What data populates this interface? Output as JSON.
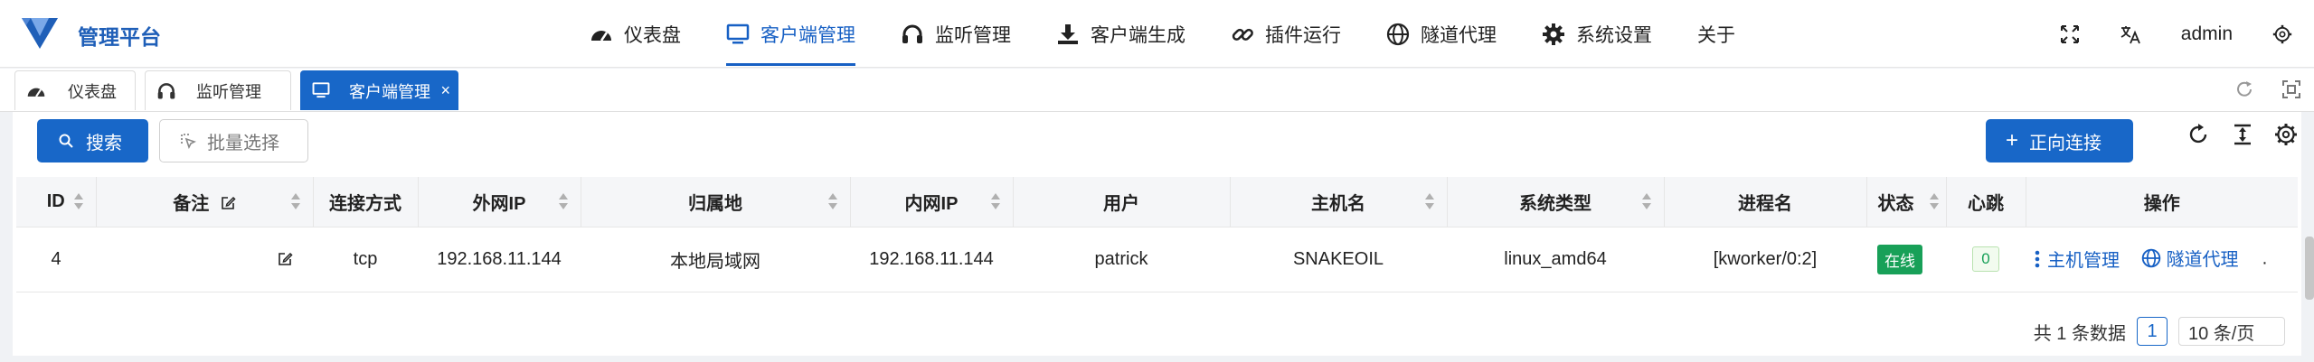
{
  "app": {
    "brand": "管理平台",
    "colors": {
      "primary": "#1867c8",
      "online": "#18a058",
      "header_bg": "#f5f6f8"
    }
  },
  "nav": {
    "items": [
      {
        "label": "仪表盘",
        "icon": "dashboard-icon"
      },
      {
        "label": "客户端管理",
        "icon": "monitor-icon",
        "active": true
      },
      {
        "label": "监听管理",
        "icon": "headphones-icon"
      },
      {
        "label": "客户端生成",
        "icon": "download-icon"
      },
      {
        "label": "插件运行",
        "icon": "link-icon"
      },
      {
        "label": "隧道代理",
        "icon": "globe-icon"
      },
      {
        "label": "系统设置",
        "icon": "gear-icon"
      },
      {
        "label": "关于",
        "icon": ""
      }
    ],
    "user": "admin"
  },
  "tabs": [
    {
      "label": "仪表盘",
      "icon": "dashboard-icon"
    },
    {
      "label": "监听管理",
      "icon": "headphones-icon"
    },
    {
      "label": "客户端管理",
      "icon": "monitor-icon",
      "active": true,
      "close": "×"
    }
  ],
  "toolbar": {
    "search": "搜索",
    "batch": "批量选择",
    "forward": "正向连接"
  },
  "table": {
    "headers": [
      "ID",
      "备注",
      "连接方式",
      "外网IP",
      "归属地",
      "内网IP",
      "用户",
      "主机名",
      "系统类型",
      "进程名",
      "状态",
      "心跳",
      "操作"
    ],
    "rows": [
      {
        "id": "4",
        "remark": "",
        "conn": "tcp",
        "wan_ip": "192.168.11.144",
        "location": "本地局域网",
        "lan_ip": "192.168.11.144",
        "user": "patrick",
        "hostname": "SNAKEOIL",
        "os": "linux_amd64",
        "process": "[kworker/0:2]",
        "status": "在线",
        "heartbeat": "0",
        "op_host": "主机管理",
        "op_tunnel": "隧道代理"
      }
    ]
  },
  "pager": {
    "total": "共 1 条数据",
    "page": "1",
    "size": "10 条/页"
  }
}
